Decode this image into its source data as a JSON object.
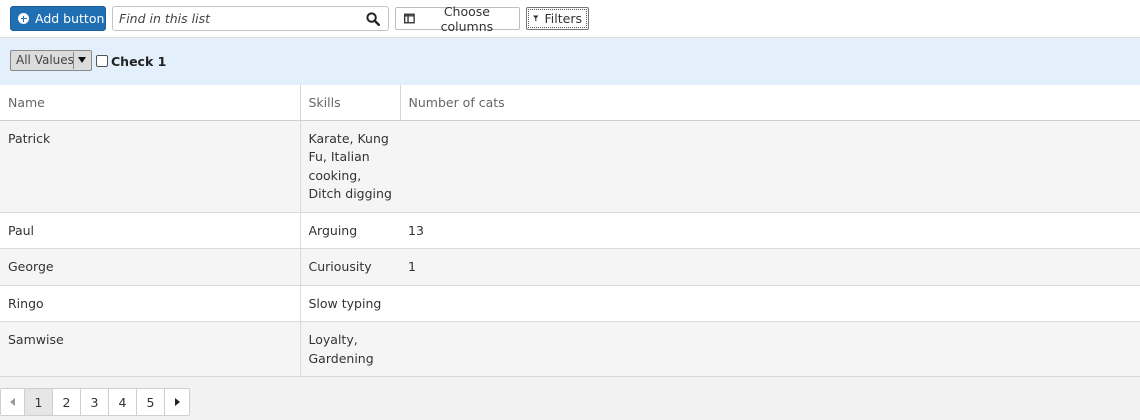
{
  "toolbar": {
    "add_label": "Add button",
    "search_placeholder": "Find in this list",
    "search_value": "",
    "columns_label": "Choose columns",
    "filters_label": "Filters",
    "accent_color": "#1f6fb2"
  },
  "filter_bar": {
    "select_value": "All Values",
    "checkbox_label": "Check 1",
    "checkbox_checked": false,
    "background_color": "#e3f0fb"
  },
  "table": {
    "headers": [
      "Name",
      "Skills",
      "Number of cats"
    ],
    "rows": [
      {
        "name": "Patrick",
        "skills": "Karate, Kung Fu, Italian cooking, Ditch digging",
        "cats": ""
      },
      {
        "name": "Paul",
        "skills": "Arguing",
        "cats": "13"
      },
      {
        "name": "George",
        "skills": "Curiousity",
        "cats": "1"
      },
      {
        "name": "Ringo",
        "skills": "Slow typing",
        "cats": ""
      },
      {
        "name": "Samwise",
        "skills": "Loyalty, Gardening",
        "cats": ""
      }
    ]
  },
  "pagination": {
    "pages": [
      "1",
      "2",
      "3",
      "4",
      "5"
    ],
    "current": "1",
    "icons": [
      "previous-page-icon",
      "next-page-icon"
    ]
  }
}
